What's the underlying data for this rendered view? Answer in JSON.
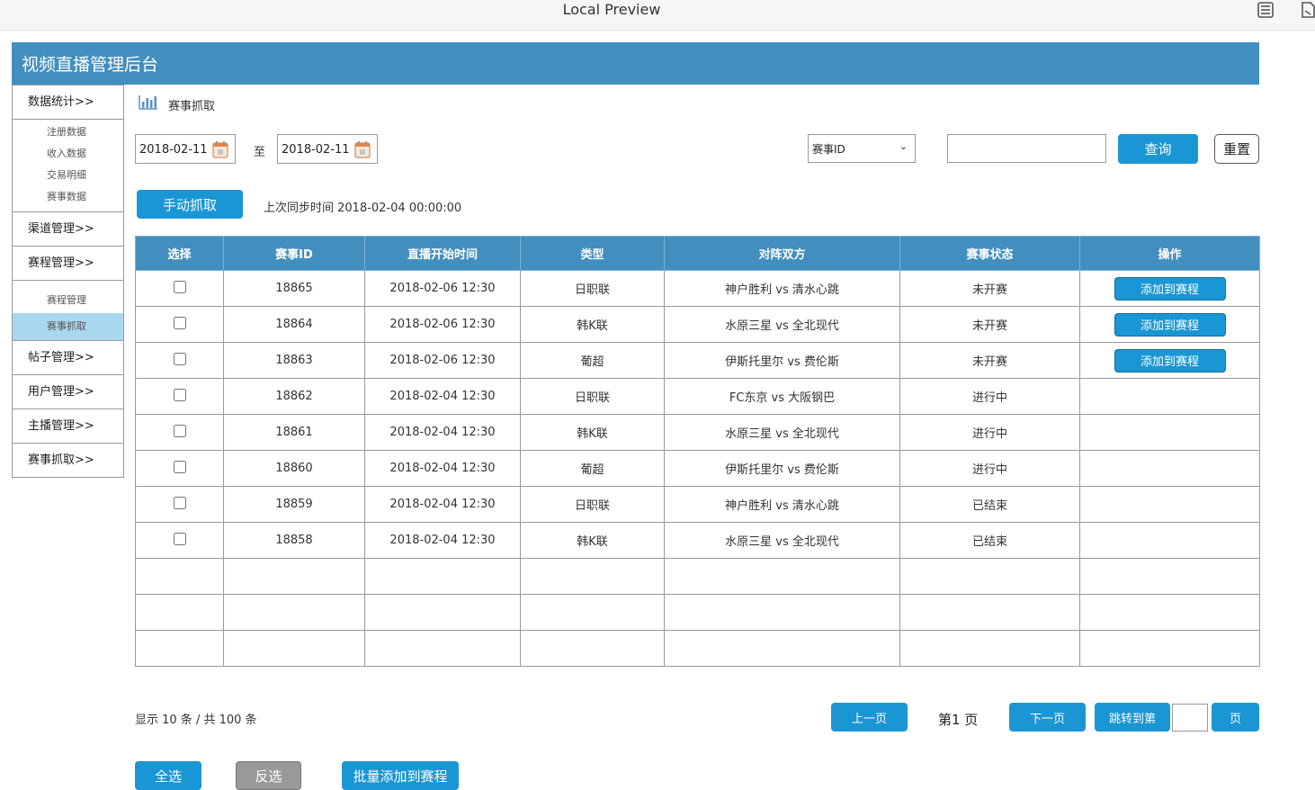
{
  "window": {
    "title": "Local Preview"
  },
  "app": {
    "title": "视频直播管理后台"
  },
  "sidebar": [
    {
      "label": "数据统计>>",
      "items": [
        "注册数据",
        "收入数据",
        "交易明细",
        "赛事数据"
      ]
    },
    {
      "label": "渠道管理>>",
      "items": []
    },
    {
      "label": "赛程管理>>",
      "items": [
        "赛程管理",
        "赛事抓取"
      ]
    },
    {
      "label": "帖子管理>>",
      "items": []
    },
    {
      "label": "用户管理>>",
      "items": []
    },
    {
      "label": "主播管理>>",
      "items": []
    },
    {
      "label": "赛事抓取>>",
      "items": []
    }
  ],
  "breadcrumb": "赛事抓取",
  "filters": {
    "start_date": "2018-02-11",
    "to_label": "至",
    "end_date": "2018-02-11",
    "field_select": "赛事ID",
    "search_value": "",
    "query_label": "查询",
    "reset_label": "重置"
  },
  "manual_fetch_label": "手动抓取",
  "sync_text": "上次同步时间  2018-02-04   00:00:00",
  "table": {
    "headers": [
      "选择",
      "赛事ID",
      "直播开始时间",
      "类型",
      "对阵双方",
      "赛事状态",
      "操作"
    ],
    "rows": [
      {
        "id": "18865",
        "time": "2018-02-06  12:30",
        "type": "日职联",
        "match": "神户胜利 vs 清水心跳",
        "status": "未开赛",
        "action": "添加到赛程"
      },
      {
        "id": "18864",
        "time": "2018-02-06  12:30",
        "type": "韩K联",
        "match": "水原三星 vs 全北现代",
        "status": "未开赛",
        "action": "添加到赛程"
      },
      {
        "id": "18863",
        "time": "2018-02-06  12:30",
        "type": "葡超",
        "match": "伊斯托里尔 vs 费伦斯",
        "status": "未开赛",
        "action": "添加到赛程"
      },
      {
        "id": "18862",
        "time": "2018-02-04  12:30",
        "type": "日职联",
        "match": "FC东京 vs 大阪钢巴",
        "status": "进行中",
        "action": ""
      },
      {
        "id": "18861",
        "time": "2018-02-04  12:30",
        "type": "韩K联",
        "match": "水原三星 vs 全北现代",
        "status": "进行中",
        "action": ""
      },
      {
        "id": "18860",
        "time": "2018-02-04  12:30",
        "type": "葡超",
        "match": "伊斯托里尔 vs 费伦斯",
        "status": "进行中",
        "action": ""
      },
      {
        "id": "18859",
        "time": "2018-02-04  12:30",
        "type": "日职联",
        "match": "神户胜利 vs 清水心跳",
        "status": "已结束",
        "action": ""
      },
      {
        "id": "18858",
        "time": "2018-02-04  12:30",
        "type": "韩K联",
        "match": "水原三星 vs 全北现代",
        "status": "已结束",
        "action": ""
      }
    ],
    "empty_rows": 3
  },
  "pagination": {
    "summary": "显示  10 条  / 共 100 条",
    "prev_label": "上一页",
    "page_label": "第1 页",
    "next_label": "下一页",
    "jump_label": "跳转到第",
    "jump_value": "",
    "page_suffix": "页"
  },
  "bulk": {
    "select_all": "全选",
    "invert": "反选",
    "batch_add": "批量添加到赛程"
  },
  "colors": {
    "header_bg": "#428fbf",
    "button_blue": "#1a96d4",
    "status_pending": "#333333",
    "status_live": "#1d8c1d",
    "status_ended": "#e01a1a",
    "active_nav": "#a9d8ee"
  }
}
